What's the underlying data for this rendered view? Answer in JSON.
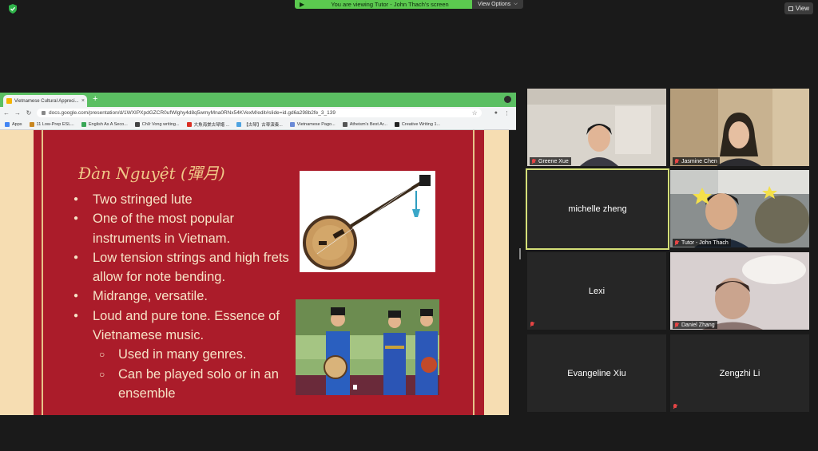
{
  "banner": {
    "text": "You are viewing Tutor - John Thach's screen",
    "view_options": "View Options"
  },
  "view_button": "View",
  "browser": {
    "tab_title": "Vietnamese Cultural Appreci...",
    "url": "docs.google.com/presentation/d/1WXIPXpdGZCR0ufWlghy4d8q5wmyMna0RNx54KVexM/edit#slide=id.gd6a298b2fe_3_139",
    "bookmarks": [
      "Apps",
      "11 Low-Prep ESL...",
      "English As A Seco...",
      "Chữ Vong writing...",
      "大魚海棠古琴譜 ...",
      "【古琴】古琴演奏...",
      "Vietnamese Pago...",
      "Atheism's Best Ar...",
      "Creative Writing 1..."
    ]
  },
  "slide": {
    "title": "Đàn Nguyệt (彈月)",
    "bullets": [
      "Two stringed lute",
      "One of the most popular instruments in Vietnam.",
      "Low tension strings and high frets allow for note bending.",
      "Midrange, versatile.",
      "Loud and pure tone. Essence of Vietnamese music."
    ],
    "sub_bullets": [
      "Used in many genres.",
      "Can be played solo or in an ensemble"
    ]
  },
  "participants": [
    {
      "name": "Greene Xue",
      "video": true,
      "muted": true
    },
    {
      "name": "Jasmine Chen",
      "video": true,
      "muted": true
    },
    {
      "name": "michelle zheng",
      "video": false,
      "muted": false,
      "active": true
    },
    {
      "name": "Tutor - John Thach",
      "video": true,
      "muted": true
    },
    {
      "name": "Lexi",
      "video": false,
      "muted": true
    },
    {
      "name": "Daniel Zhang",
      "video": true,
      "muted": true
    },
    {
      "name": "Evangeline Xiu",
      "video": false,
      "muted": false
    },
    {
      "name": "Zengzhi Li",
      "video": false,
      "muted": true
    }
  ],
  "colors": {
    "banner_green": "#5bc94f",
    "slide_red": "#ab1c2a",
    "slide_gold": "#f0c888",
    "active_border": "#d4df78"
  }
}
